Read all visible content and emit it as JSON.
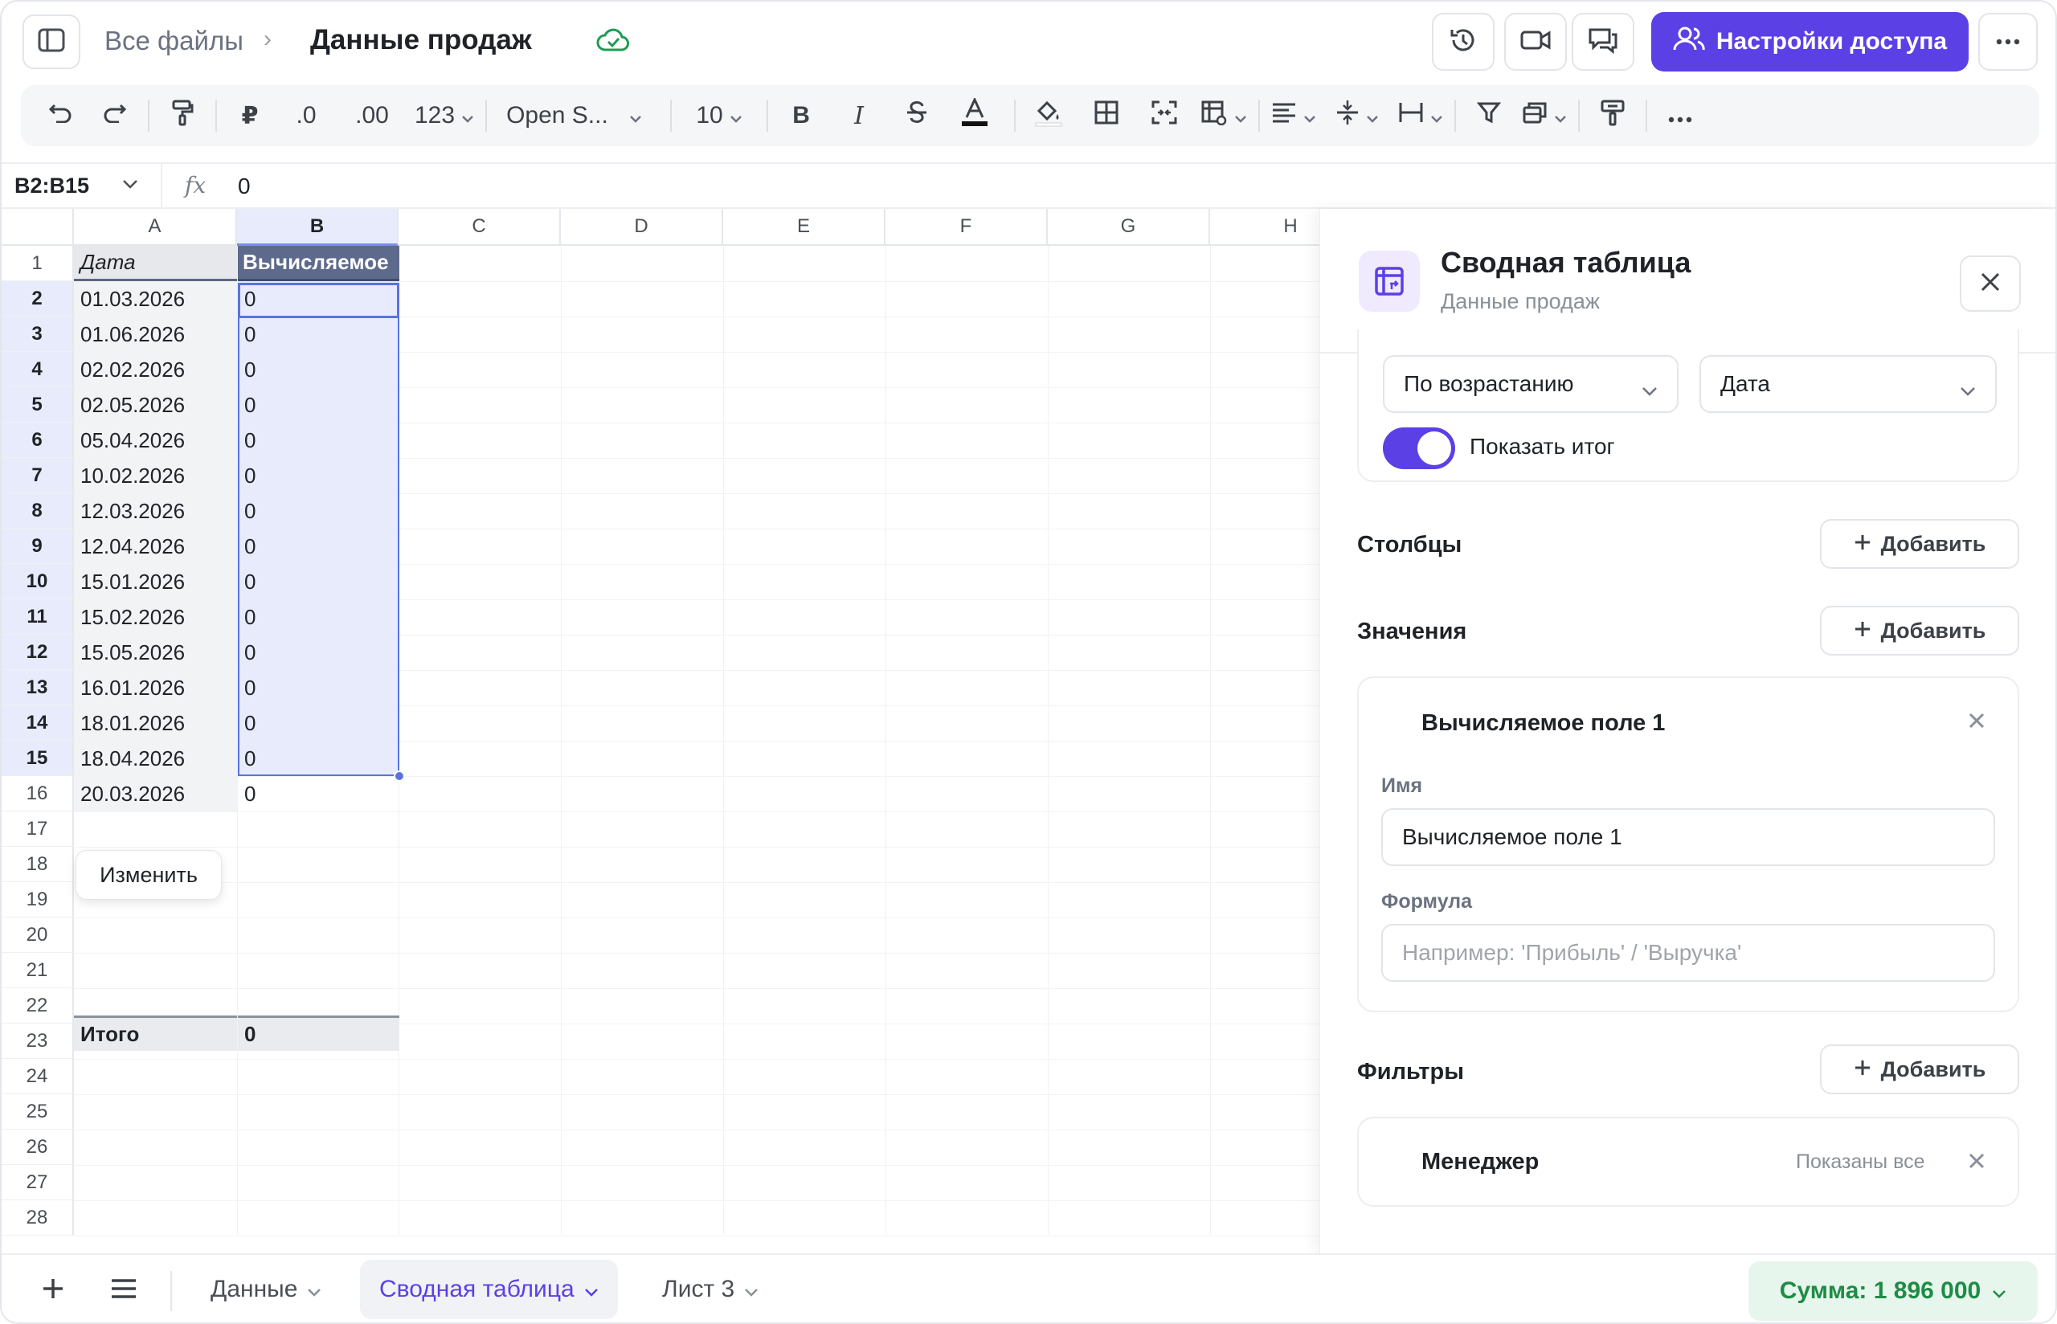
{
  "header": {
    "breadcrumb_root": "Все файлы",
    "breadcrumb_sep": "›",
    "title": "Данные продаж",
    "share_label": "Настройки доступа"
  },
  "toolbar": {
    "currency_symbol": "₽",
    "decimal_decrease": ".0",
    "decimal_increase": ".00",
    "number_format": "123",
    "font": "Open S...",
    "font_size": "10",
    "bold": "B",
    "italic": "I"
  },
  "formula_bar": {
    "cell_ref": "B2:B15",
    "fx": "fx",
    "value": "0"
  },
  "grid": {
    "columns": [
      "A",
      "B",
      "C",
      "D",
      "E",
      "F",
      "G",
      "H"
    ],
    "rows": [
      "1",
      "2",
      "3",
      "4",
      "5",
      "6",
      "7",
      "8",
      "9",
      "10",
      "11",
      "12",
      "13",
      "14",
      "15",
      "16",
      "17",
      "18",
      "19",
      "20",
      "21",
      "22",
      "23",
      "24",
      "25",
      "26",
      "27",
      "28"
    ],
    "header_a": "Дата",
    "header_b": "Вычисляемое",
    "dates": [
      "01.03.2026",
      "01.06.2026",
      "02.02.2026",
      "02.05.2026",
      "05.04.2026",
      "10.02.2026",
      "12.03.2026",
      "12.04.2026",
      "15.01.2026",
      "15.02.2026",
      "15.05.2026",
      "16.01.2026",
      "18.01.2026",
      "18.04.2026",
      "20.03.2026"
    ],
    "values": [
      "0",
      "0",
      "0",
      "0",
      "0",
      "0",
      "0",
      "0",
      "0",
      "0",
      "0",
      "0",
      "0",
      "0",
      "0"
    ],
    "total_label": "Итого",
    "total_value": "0",
    "edit_button": "Изменить"
  },
  "panel": {
    "title": "Сводная таблица",
    "subtitle": "Данные продаж",
    "sort_order": "По возрастанию",
    "sort_field": "Дата",
    "show_total_label": "Показать итог",
    "show_total_on": true,
    "columns_title": "Столбцы",
    "values_title": "Значения",
    "filters_title": "Фильтры",
    "add_label": "Добавить",
    "value_field": {
      "name": "Вычисляемое поле 1",
      "name_label": "Имя",
      "name_value": "Вычисляемое поле 1",
      "formula_label": "Формула",
      "formula_placeholder": "Например: 'Прибыль' / 'Выручка'"
    },
    "filter_field": {
      "name": "Менеджер",
      "status": "Показаны все"
    }
  },
  "sheets": {
    "tabs": [
      "Данные",
      "Сводная таблица",
      "Лист 3"
    ],
    "active": "Сводная таблица",
    "sum_label": "Сумма: 1 896 000"
  },
  "colors": {
    "accent": "#5b40e6",
    "selection": "#5a73e0",
    "sum_green": "#1e8c45"
  }
}
